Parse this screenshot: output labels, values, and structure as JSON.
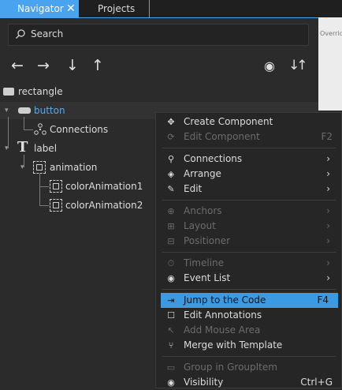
{
  "tabs": {
    "navigator": "Navigator",
    "projects": "Projects",
    "close_symbol": "✕"
  },
  "right_pane": {
    "overrides_label": "Overrid"
  },
  "search": {
    "placeholder": "Search"
  },
  "toolbar": {
    "left": "←",
    "right": "→",
    "down": "↓",
    "up": "↑",
    "visibility": "◉",
    "sort": "↓↑"
  },
  "tree": {
    "root": "rectangle",
    "button": "button",
    "connections": "Connections",
    "label": "label",
    "animation": "animation",
    "anim1": "colorAnimation1",
    "anim2": "colorAnimation2"
  },
  "menu": {
    "create_component": "Create Component",
    "edit_component": "Edit Component",
    "edit_component_shortcut": "F2",
    "connections": "Connections",
    "arrange": "Arrange",
    "edit": "Edit",
    "anchors": "Anchors",
    "layout": "Layout",
    "positioner": "Positioner",
    "timeline": "Timeline",
    "event_list": "Event List",
    "jump_to_code": "Jump to the Code",
    "jump_to_code_shortcut": "F4",
    "edit_annotations": "Edit Annotations",
    "add_mouse_area": "Add Mouse Area",
    "merge_with_template": "Merge with Template",
    "group_in_groupitem": "Group in GroupItem",
    "visibility": "Visibility",
    "visibility_shortcut": "Ctrl+G",
    "submenu_arrow": "›"
  },
  "colors": {
    "accent": "#4aa3ee",
    "highlight": "#3b9ae1",
    "selected_text": "#55aaee"
  }
}
